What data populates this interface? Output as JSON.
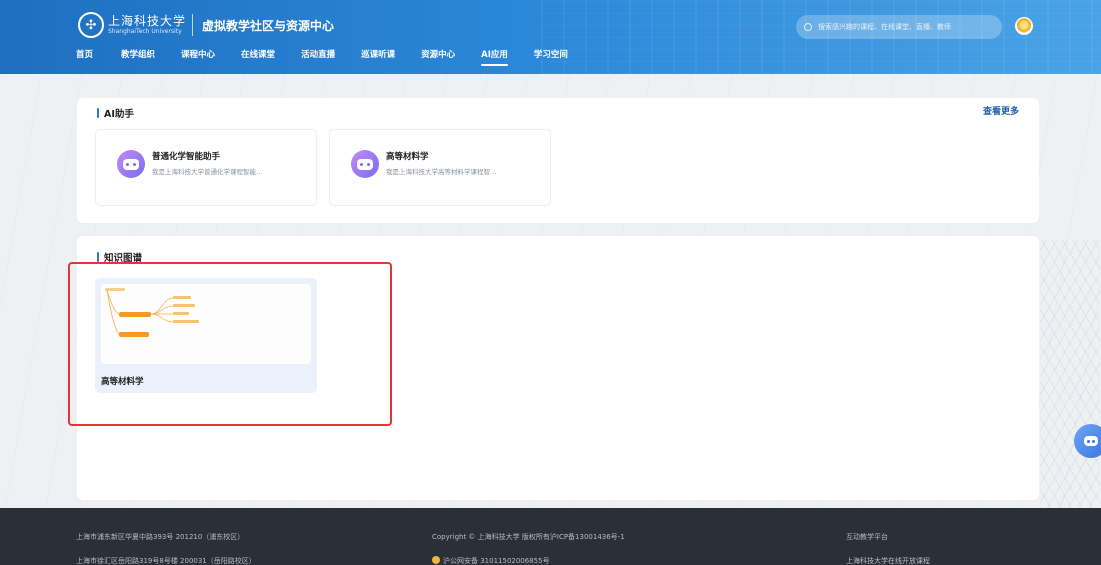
{
  "header": {
    "university_cn": "上海科技大学",
    "university_en": "ShanghaiTech University",
    "site_title": "虚拟教学社区与资源中心",
    "search_placeholder": "搜索感兴趣的课程、在线课堂、直播、教师",
    "nav": [
      {
        "label": "首页",
        "active": false
      },
      {
        "label": "教学组织",
        "active": false
      },
      {
        "label": "课程中心",
        "active": false
      },
      {
        "label": "在线课堂",
        "active": false
      },
      {
        "label": "活动直播",
        "active": false
      },
      {
        "label": "巡课听课",
        "active": false
      },
      {
        "label": "资源中心",
        "active": false
      },
      {
        "label": "AI应用",
        "active": true
      },
      {
        "label": "学习空间",
        "active": false
      }
    ]
  },
  "ai_section": {
    "title": "AI助手",
    "more_label": "查看更多",
    "cards": [
      {
        "name": "普通化学智能助手",
        "desc": "我是上海科技大学普通化学课程智能…",
        "icon": "robot-icon"
      },
      {
        "name": "高等材料学",
        "desc": "我是上海科技大学高等材料学课程智…",
        "icon": "robot-icon"
      }
    ]
  },
  "kg_section": {
    "title": "知识图谱",
    "cards": [
      {
        "title": "高等材料学",
        "thumbnail": "mindmap-thumbnail"
      }
    ]
  },
  "footer": {
    "address1": "上海市浦东新区华夏中路393号 201210（浦东校区）",
    "address2": "上海市徐汇区岳阳路319号8号楼 200031（岳阳路校区）",
    "copyright": "Copyright © 上海科技大学 版权所有沪ICP备13001436号-1",
    "police": "沪公网安备 31011502006855号",
    "link1": "互动教学平台",
    "link2": "上海科技大学在线开放课程"
  },
  "colors": {
    "header_start": "#1f6fc0",
    "header_end": "#4aa3e6",
    "accent": "#2878d0",
    "highlight": "#e2353a",
    "footer_bg": "#2b2f37"
  }
}
